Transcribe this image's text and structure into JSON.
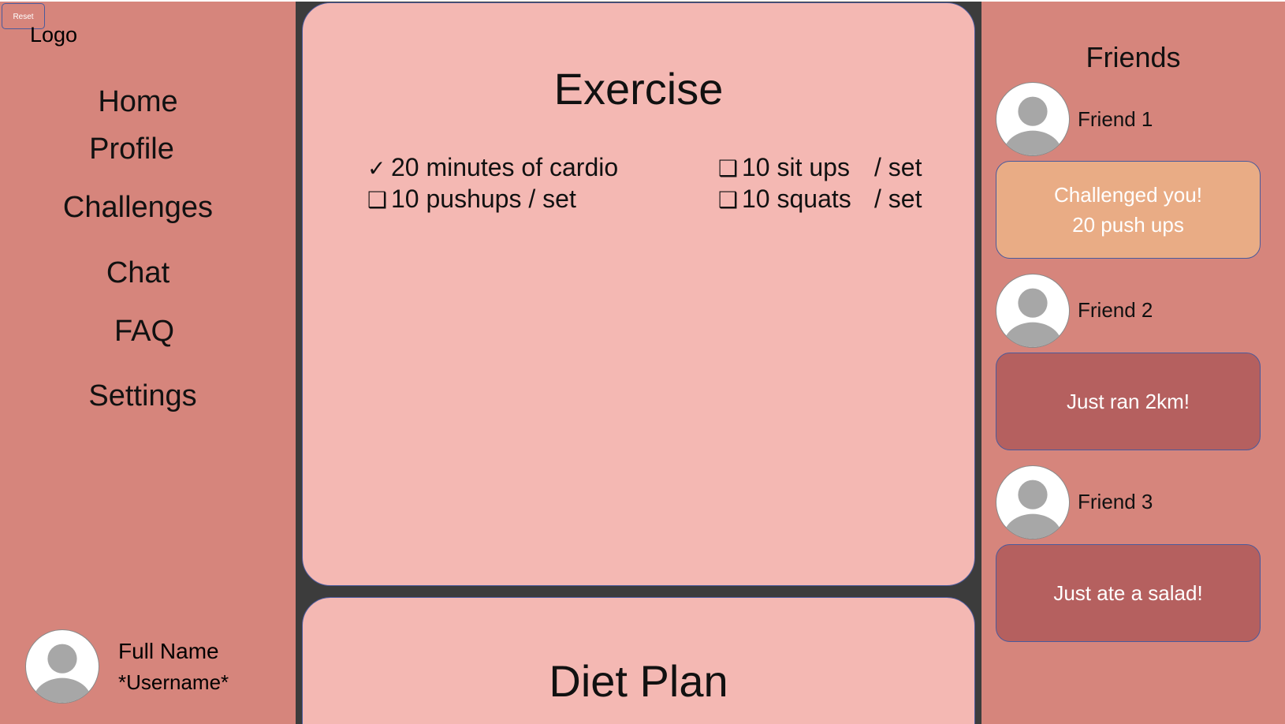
{
  "header": {
    "reset_label": "Reset",
    "logo_text": "Logo"
  },
  "sidebar": {
    "nav": [
      "Home",
      "Profile",
      "Challenges",
      "Chat",
      "FAQ",
      "Settings"
    ],
    "user": {
      "full_name": "Full Name",
      "username": "*Username*",
      "avatar_icon": "user-avatar-icon"
    }
  },
  "exercise": {
    "title": "Exercise",
    "tasks": [
      {
        "label": "20 minutes of cardio",
        "unit": "",
        "done": true,
        "mark": "✓"
      },
      {
        "label": "10 pushups / set",
        "unit": "",
        "done": false,
        "mark": "❑"
      },
      {
        "label": "10 sit ups",
        "unit": "/ set",
        "done": false,
        "mark": "❑"
      },
      {
        "label": "10 squats",
        "unit": "/ set",
        "done": false,
        "mark": "❑"
      }
    ]
  },
  "diet": {
    "title": "Diet Plan"
  },
  "friends": {
    "title": "Friends",
    "list": [
      {
        "name": "Friend 1",
        "activity_lines": [
          "Challenged you!",
          "20 push ups"
        ],
        "kind": "challenge"
      },
      {
        "name": "Friend 2",
        "activity_lines": [
          "Just ran 2km!"
        ],
        "kind": "update"
      },
      {
        "name": "Friend 3",
        "activity_lines": [
          "Just ate a salad!"
        ],
        "kind": "update"
      }
    ]
  },
  "colors": {
    "sidebar_bg": "#d6857c",
    "card_bg": "#f4b8b3",
    "divider_bg": "#3c3c3c",
    "challenge_bg": "#e9ac85",
    "update_bg": "#b5605f",
    "border": "#4a5a9c"
  }
}
